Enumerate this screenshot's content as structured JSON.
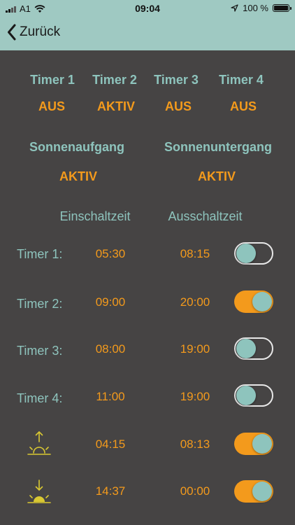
{
  "status": {
    "carrier": "A1",
    "time": "09:04",
    "battery": "100 %"
  },
  "nav": {
    "back_label": "Zurück"
  },
  "timers_header": [
    {
      "label": "Timer 1",
      "state": "AUS"
    },
    {
      "label": "Timer 2",
      "state": "AKTIV"
    },
    {
      "label": "Timer 3",
      "state": "AUS"
    },
    {
      "label": "Timer 4",
      "state": "AUS"
    }
  ],
  "sun_header": [
    {
      "label": "Sonnenaufgang",
      "state": "AKTIV"
    },
    {
      "label": "Sonnenuntergang",
      "state": "AKTIV"
    }
  ],
  "columns": {
    "on_time": "Einschaltzeit",
    "off_time": "Ausschaltzeit"
  },
  "rows": [
    {
      "label": "Timer 1:",
      "on": "05:30",
      "off": "08:15",
      "enabled": false
    },
    {
      "label": "Timer 2:",
      "on": "09:00",
      "off": "20:00",
      "enabled": true
    },
    {
      "label": "Timer 3:",
      "on": "08:00",
      "off": "19:00",
      "enabled": false
    },
    {
      "label": "Timer 4:",
      "on": "11:00",
      "off": "19:00",
      "enabled": false
    },
    {
      "icon": "sunrise-icon",
      "on": "04:15",
      "off": "08:13",
      "enabled": true
    },
    {
      "icon": "sunset-icon",
      "on": "14:37",
      "off": "00:00",
      "enabled": true
    }
  ],
  "colors": {
    "accent": "#f39a1c",
    "teal": "#8ec4bd",
    "background": "#464444",
    "bar": "#9fc9c2"
  }
}
